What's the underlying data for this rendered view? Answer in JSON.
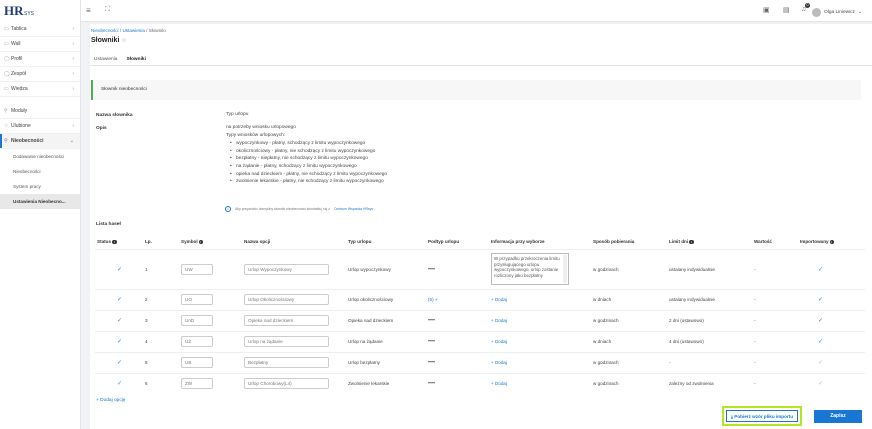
{
  "logo": {
    "main": "HR",
    "sub": "SYS"
  },
  "sidebar": {
    "items": [
      {
        "label": "Tablica",
        "icon": "dashboard-icon"
      },
      {
        "label": "Wall",
        "icon": "wall-icon"
      },
      {
        "label": "Profil",
        "icon": "profile-icon"
      },
      {
        "label": "Zespół",
        "icon": "team-icon"
      },
      {
        "label": "Wiedza",
        "icon": "knowledge-icon"
      }
    ],
    "items2": [
      {
        "label": "Moduły",
        "icon": "modules-icon"
      },
      {
        "label": "Ulubione",
        "icon": "favorites-icon"
      },
      {
        "label": "Nieobecności",
        "icon": "absence-icon"
      }
    ],
    "subs": [
      "Dodawanie nieobecności",
      "Nieobecności",
      "System pracy",
      "Ustawienia Nieobecno..."
    ]
  },
  "topbar": {
    "user": "Olga Liniewicz",
    "badge": "0"
  },
  "breadcrumb": {
    "a": "Nieobecności",
    "b": "Ustawienia",
    "c": "Słowniki"
  },
  "page": {
    "title": "Słowniki",
    "tabs": [
      "Ustawienia",
      "Słowniki"
    ]
  },
  "section": {
    "title": "Słownik nieobecności"
  },
  "fields": {
    "name_label": "Nazwa słownika",
    "name_value": "Typ urlopu",
    "desc_label": "Opis",
    "desc_lines": [
      "na potrzeby wniosku urlopowego",
      "Typy wniosków urlopowych:"
    ],
    "desc_bullets": [
      "wypoczynkowy - płatny, schodzący z limitu wypoczynkowego",
      "okolicznościowy - płatny, nie schodzący z limitu wypoczynkowego",
      "bezpłatny - niepłatny, nie schodzący z limitu wypoczynkowego",
      "na żądanie - płatny, schodzący z limitu wypoczynkowego",
      "opieka nad dzieckiem - płatny, nie schodzący z limitu wypoczynkowego",
      "zwolnienie lekarskie - płatny, nie schodzący z limitu wypoczynkowego"
    ]
  },
  "info": {
    "text": "Aby przywrócić domyślny słownik nieobecności skontaktuj się z",
    "link": "Centrum Wsparcia HRsys"
  },
  "list": {
    "title": "Lista haseł",
    "headers": [
      "Status",
      "Lp.",
      "Symbol",
      "Nazwa opcji",
      "Typ urlopu",
      "Podtyp urlopu",
      "Informacja przy wyborze",
      "Sposób pobierania",
      "Limit dni",
      "Wartość",
      "Importowany"
    ],
    "rows": [
      {
        "lp": "1",
        "symbol": "UW",
        "nazwa": "Urlop Wypoczynkowy",
        "typ": "Urlop wypoczynkowy",
        "podtyp": "dash",
        "info": "W przypadku przekroczenia limitu przysługującego urlopu wypoczynkowego, urlop zostanie rozliczony jako bezpłatny",
        "sposob": "w godzinach",
        "limit": "ustalany indywidualnie",
        "wartosc": "-",
        "imp": true
      },
      {
        "lp": "2",
        "symbol": "UO",
        "nazwa": "Urlop Okolicznościowy",
        "typ": "Urlop okolicznościowy",
        "podtyp": "(5) +",
        "info": "+ Dodaj",
        "sposob": "w dniach",
        "limit": "ustalany indywidualnie",
        "wartosc": "-",
        "imp": true
      },
      {
        "lp": "3",
        "symbol": "UnD",
        "nazwa": "Opieka nad dzieckiem",
        "typ": "Opieka nad dzieckiem",
        "podtyp": "dash",
        "info": "+ Dodaj",
        "sposob": "w godzinach",
        "limit": "2 dni (ustawowo)",
        "wartosc": "-",
        "imp": true
      },
      {
        "lp": "4",
        "symbol": "UŻ",
        "nazwa": "Urlop na żądanie",
        "typ": "Urlop na żądanie",
        "podtyp": "dash",
        "info": "+ Dodaj",
        "sposob": "w dniach",
        "limit": "4 dni (ustawowo)",
        "wartosc": "-",
        "imp": true
      },
      {
        "lp": "5",
        "symbol": "UB",
        "nazwa": "Bezpłatny",
        "typ": "Urlop bezpłatny",
        "podtyp": "dash",
        "info": "+ Dodaj",
        "sposob": "w godzinach",
        "limit": "-",
        "wartosc": "-",
        "imp": false
      },
      {
        "lp": "6",
        "symbol": "ZW",
        "nazwa": "Urlop Chorobowy(L4)",
        "typ": "Zwolnienie lekarskie",
        "podtyp": "dash",
        "info": "+ Dodaj",
        "sposob": "w godzinach",
        "limit": "zależny od zwolnienia",
        "wartosc": "-",
        "imp": false
      }
    ]
  },
  "actions": {
    "add_option": "+ Dodaj opcję",
    "import": "Pobierz wzór pliku importu",
    "save": "Zapisz"
  }
}
